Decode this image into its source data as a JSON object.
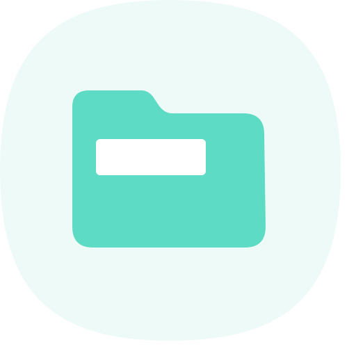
{
  "icon": {
    "name": "folder-icon",
    "tile_color": "#EEFAF8",
    "folder_color": "#5EDBC4",
    "label_color": "#FFFFFF"
  }
}
